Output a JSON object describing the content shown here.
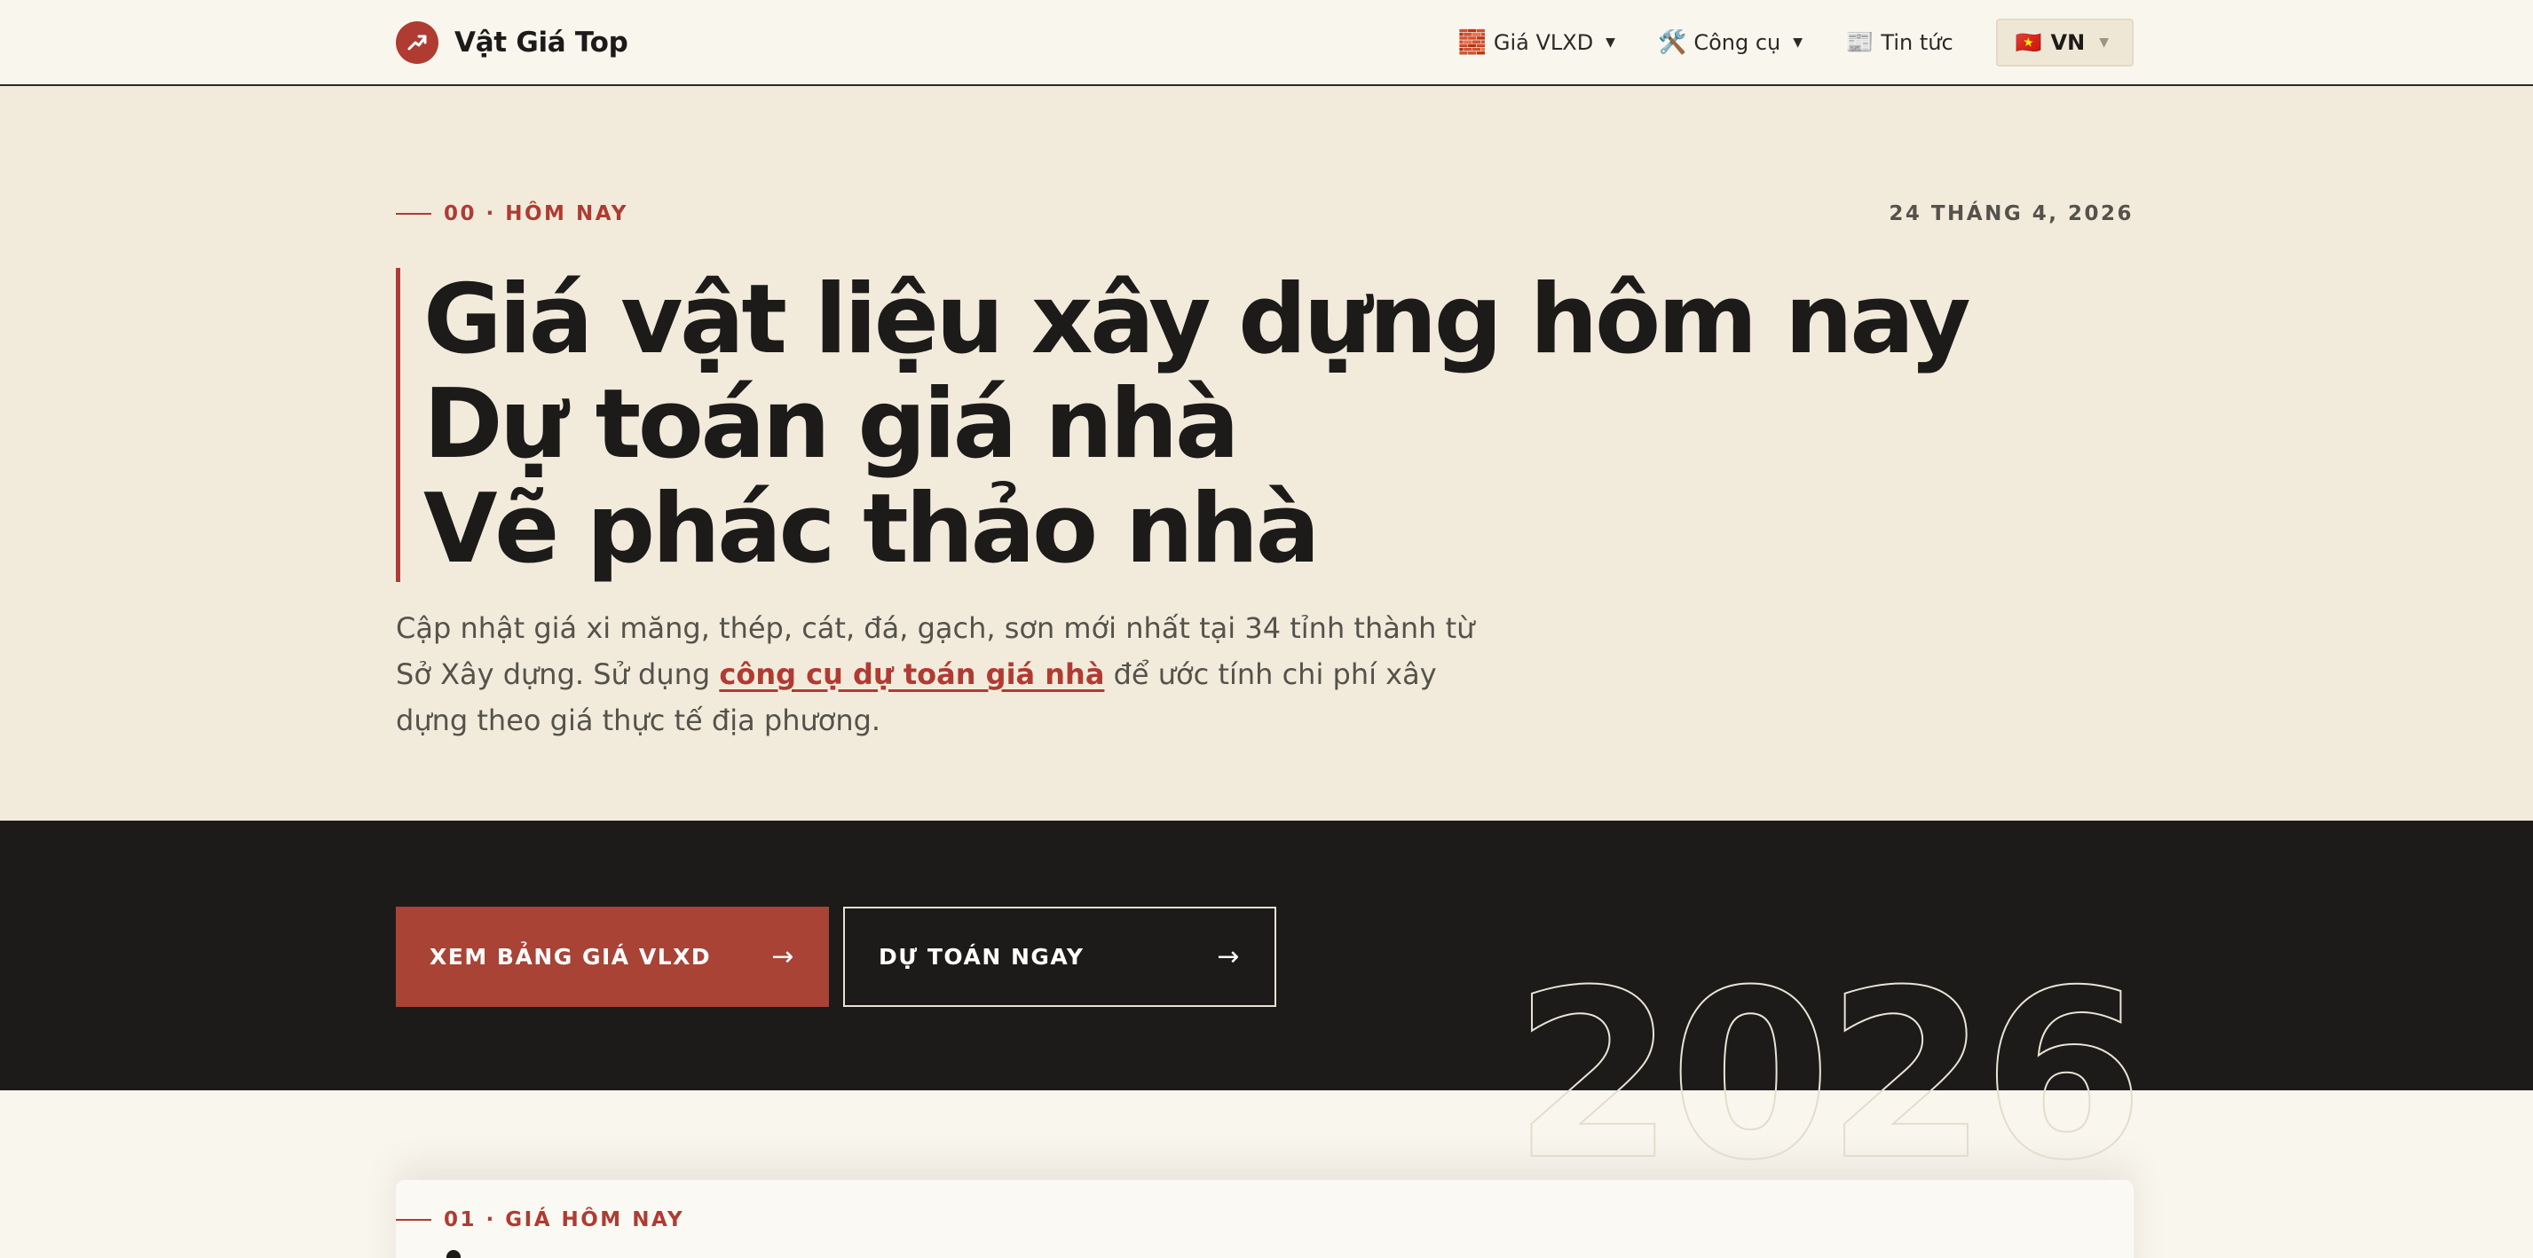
{
  "header": {
    "brand_name": "Vật Giá Top",
    "nav": [
      {
        "icon": "brick-icon",
        "emoji": "🧱",
        "label": "Giá VLXD",
        "has_dropdown": true
      },
      {
        "icon": "tools-icon",
        "emoji": "🛠️",
        "label": "Công cụ",
        "has_dropdown": true
      },
      {
        "icon": "newspaper-icon",
        "emoji": "📰",
        "label": "Tin tức",
        "has_dropdown": false
      }
    ],
    "language": {
      "flag": "🇻🇳",
      "label": "VN"
    }
  },
  "hero": {
    "eyebrow": "00 · HÔM NAY",
    "date": "24 THÁNG 4, 2026",
    "title_lines": [
      "Giá vật liệu xây dựng hôm nay",
      "Dự toán giá nhà",
      "Vẽ phác thảo nhà"
    ],
    "lead_before": "Cập nhật giá xi măng, thép, cát, đá, gạch, sơn mới nhất tại 34 tỉnh thành từ Sở Xây dựng. Sử dụng ",
    "lead_link": "công cụ dự toán giá nhà",
    "lead_after": " để ước tính chi phí xây dựng theo giá thực tế địa phương."
  },
  "cta": {
    "primary_label": "XEM BẢNG GIÁ VLXD",
    "secondary_label": "DỰ TOÁN NGAY",
    "arrow": "→"
  },
  "decor": {
    "year": "2026"
  },
  "next_section": {
    "eyebrow": "01 · GIÁ HÔM NAY"
  },
  "colors": {
    "accent": "#b03b32",
    "dark": "#1c1b19",
    "hero_bg": "#f2ebdc",
    "page_bg": "#f9f6ee"
  }
}
